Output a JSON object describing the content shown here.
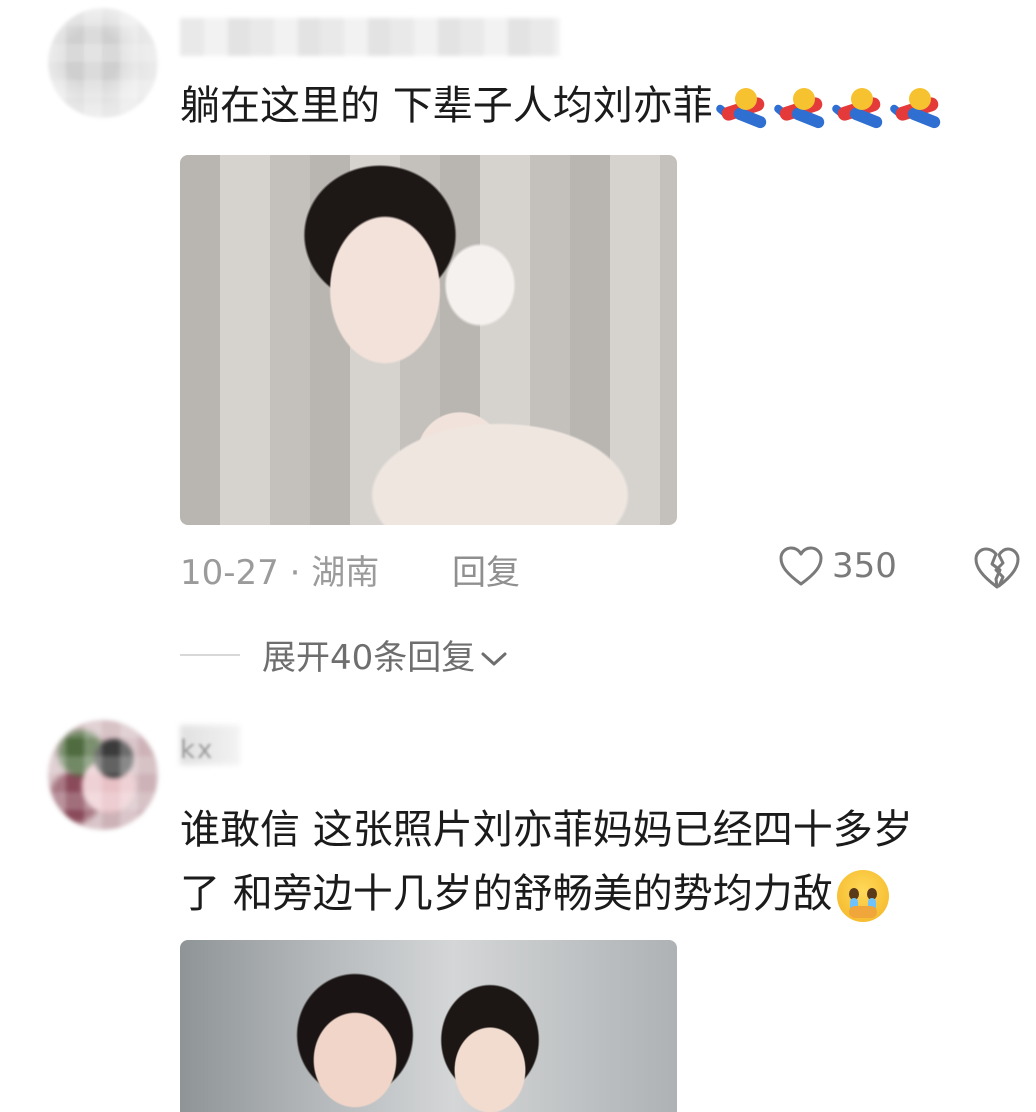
{
  "comments": [
    {
      "text": "躺在这里的 下辈子人均刘亦菲",
      "emoji": "running-person-emoji",
      "emoji_count": 4,
      "date": "10-27",
      "separator": "·",
      "location": "湖南",
      "reply_label": "回复",
      "likes": "350",
      "expand_label": "展开40条回复"
    },
    {
      "username": "kx",
      "line1": "谁敢信 这张照片刘亦菲妈妈已经四十多岁",
      "line2": "了 和旁边十几岁的舒畅美的势均力敌",
      "emoji": "crying-emoji"
    }
  ],
  "colors": {
    "text": "#1b1b1b",
    "meta": "#9b9b9b",
    "icon": "#7a7a7a"
  }
}
